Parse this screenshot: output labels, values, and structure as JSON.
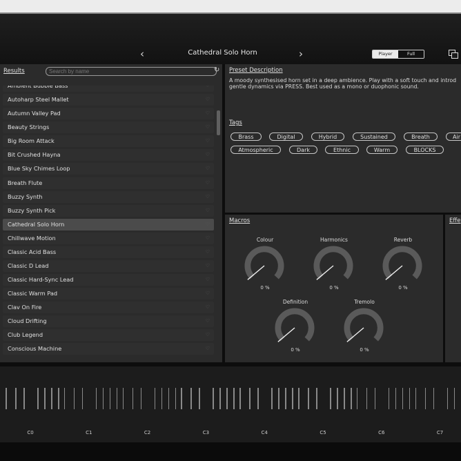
{
  "header": {
    "prev_icon": "chevron-left",
    "next_icon": "chevron-right",
    "preset_title": "Cathedral Solo Horn",
    "mode_player": "Player",
    "mode_full": "Full",
    "window_icon": "window-copy-icon"
  },
  "results": {
    "label": "Results",
    "search_placeholder": "Search by name",
    "items": [
      "Ambient Bubble Bass",
      "Autoharp Steel Mallet",
      "Autumn Valley Pad",
      "Beauty Strings",
      "Big Room Attack",
      "Bit Crushed Hayna",
      "Blue Sky Chimes Loop",
      "Breath Flute",
      "Buzzy Synth",
      "Buzzy Synth Pick",
      "Cathedral Solo Horn",
      "Chillwave Motion",
      "Classic Acid Bass",
      "Classic D Lead",
      "Classic Hard-Sync Lead",
      "Classic Warm Pad",
      "Clav On Fire",
      "Cloud Drifting",
      "Club Legend",
      "Conscious Machine"
    ],
    "selected_index": 10
  },
  "description": {
    "label": "Preset Description",
    "line1": "A moody synthesised horn set in a deep ambience. Play with a soft touch and introd",
    "line2": "gentle dynamics via PRESS. Best used as a mono or duophonic sound."
  },
  "tags": {
    "label": "Tags",
    "row1": [
      "Brass",
      "Digital",
      "Hybrid",
      "Sustained",
      "Breath",
      "Air"
    ],
    "row2": [
      "Atmospheric",
      "Dark",
      "Ethnic",
      "Warm",
      "BLOCKS"
    ]
  },
  "macros": {
    "label": "Macros",
    "knobs": [
      {
        "name": "Colour",
        "value": "0 %"
      },
      {
        "name": "Harmonics",
        "value": "0 %"
      },
      {
        "name": "Reverb",
        "value": "0 %"
      },
      {
        "name": "Definition",
        "value": "0 %"
      },
      {
        "name": "Tremolo",
        "value": "0 %"
      }
    ]
  },
  "effects": {
    "label": "Effe"
  },
  "keyboard": {
    "octaves": [
      "C0",
      "C1",
      "C2",
      "C3",
      "C4",
      "C5",
      "C6",
      "C7"
    ]
  },
  "colors": {
    "panel": "#2b2b2b",
    "selected_row": "#4b4b4b",
    "knob_track": "#5a5a5a"
  }
}
